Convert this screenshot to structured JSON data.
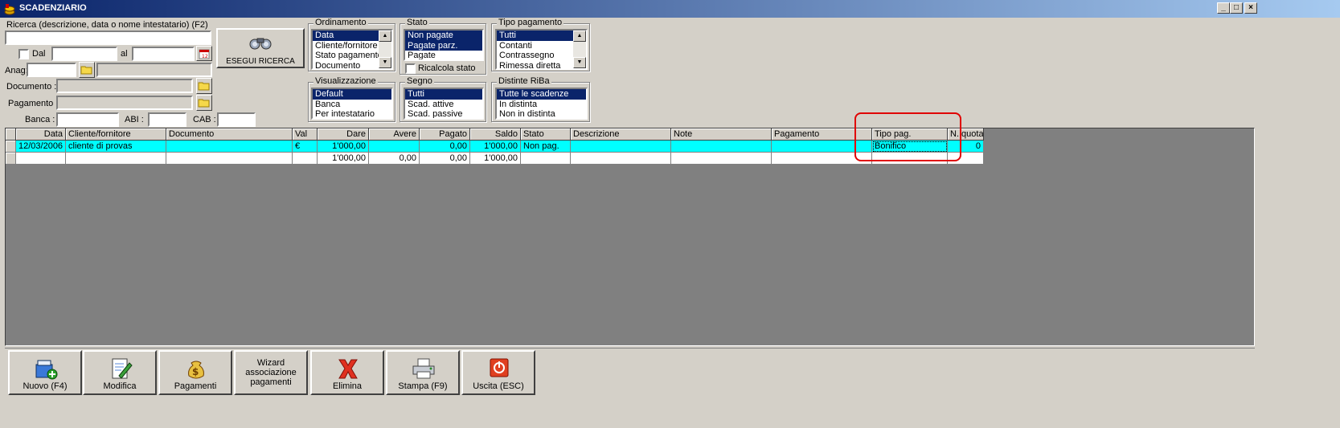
{
  "window": {
    "title": "SCADENZIARIO",
    "controls": {
      "minimize": "_",
      "maximize": "□",
      "close": "×"
    }
  },
  "search": {
    "label": "Ricerca (descrizione, data o nome intestatario) (F2)",
    "value": "",
    "dal_label": "Dal",
    "al_label": "al",
    "anag_label": "Anag:",
    "documento_label": "Documento :",
    "pagamento_label": "Pagamento :",
    "banca_label": "Banca :",
    "abi_label": "ABI :",
    "cab_label": "CAB :",
    "run_button": "ESEGUI RICERCA"
  },
  "ordinamento": {
    "title": "Ordinamento",
    "items": [
      "Data",
      "Cliente/fornitore",
      "Stato pagamento",
      "Documento"
    ],
    "selected": [
      0
    ]
  },
  "stato": {
    "title": "Stato",
    "items": [
      "Non pagate",
      "Pagate parz.",
      "Pagate"
    ],
    "selected": [
      0,
      1
    ],
    "ricalcola_label": "Ricalcola stato"
  },
  "tipo_pagamento": {
    "title": "Tipo pagamento",
    "items": [
      "Tutti",
      "Contanti",
      "Contrassegno",
      "Rimessa diretta"
    ],
    "selected": [
      0
    ]
  },
  "visualizzazione": {
    "title": "Visualizzazione",
    "items": [
      "Default",
      "Banca",
      "Per intestatario"
    ],
    "selected": [
      0
    ]
  },
  "segno": {
    "title": "Segno",
    "items": [
      "Tutti",
      "Scad. attive",
      "Scad. passive"
    ],
    "selected": [
      0
    ]
  },
  "distinte": {
    "title": "Distinte RiBa",
    "items": [
      "Tutte le scadenze",
      "In distinta",
      "Non in distinta"
    ],
    "selected": [
      0
    ]
  },
  "grid": {
    "columns": [
      "Data",
      "Cliente/fornitore",
      "Documento",
      "Val",
      "Dare",
      "Avere",
      "Pagato",
      "Saldo",
      "Stato",
      "Descrizione",
      "Note",
      "Pagamento",
      "Tipo pag.",
      "N. quota"
    ],
    "rows": [
      [
        "12/03/2006",
        "cliente di provas",
        "",
        "€",
        "1'000,00",
        "",
        "0,00",
        "1'000,00",
        "Non pag.",
        "",
        "",
        "",
        "Bonifico",
        "0"
      ],
      [
        "",
        "",
        "",
        "",
        "1'000,00",
        "0,00",
        "0,00",
        "1'000,00",
        "",
        "",
        "",
        "",
        "",
        ""
      ]
    ],
    "highlight_color": "#00ffff"
  },
  "toolbar": {
    "nuovo": "Nuovo (F4)",
    "modifica": "Modifica",
    "pagamenti": "Pagamenti",
    "wizard": "Wizard associazione pagamenti",
    "elimina": "Elimina",
    "stampa": "Stampa (F9)",
    "uscita": "Uscita (ESC)"
  },
  "icons": {
    "app": "coins-icon",
    "run": "binoculars-icon",
    "calendar": "calendar-icon",
    "folder": "folder-icon",
    "nuovo": "new-document-icon",
    "modifica": "edit-icon",
    "pagamenti": "money-bag-icon",
    "elimina": "red-x-icon",
    "stampa": "printer-icon",
    "uscita": "power-icon"
  },
  "colors": {
    "selection": "#0a246a",
    "row_highlight": "#00ffff",
    "annotation": "#e00000"
  }
}
